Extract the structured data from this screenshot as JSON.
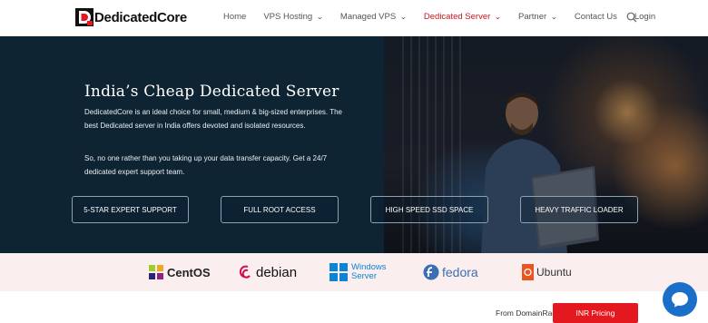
{
  "header": {
    "logo_text": "DedicatedCore",
    "nav": [
      {
        "label": "Home",
        "dropdown": false,
        "active": false
      },
      {
        "label": "VPS Hosting",
        "dropdown": true,
        "active": false
      },
      {
        "label": "Managed VPS",
        "dropdown": true,
        "active": false
      },
      {
        "label": "Dedicated Server",
        "dropdown": true,
        "active": true
      },
      {
        "label": "Partner",
        "dropdown": true,
        "active": false
      },
      {
        "label": "Contact Us",
        "dropdown": false,
        "active": false
      },
      {
        "label": "Login",
        "dropdown": false,
        "active": false
      }
    ],
    "chevron": "⌄"
  },
  "hero": {
    "title": "India’s Cheap Dedicated Server",
    "paragraph1": "DedicatedCore is an ideal choice for small, medium & big-sized enterprises. The best Dedicated server in India offers devoted and isolated resources.",
    "paragraph2": "So, no one rather than you taking up your data transfer capacity. Get a 24/7 dedicated expert support team.",
    "features": [
      "5-STAR EXPERT SUPPORT",
      "FULL ROOT ACCESS",
      "HIGH SPEED SSD SPACE",
      "HEAVY TRAFFIC LOADER"
    ]
  },
  "os_logos": [
    {
      "name": "CentOS",
      "icon": "centos-icon"
    },
    {
      "name": "debian",
      "icon": "debian-icon"
    },
    {
      "name": "Windows",
      "name2": "Server",
      "icon": "windows-icon"
    },
    {
      "name": "fedora",
      "icon": "fedora-icon"
    },
    {
      "name": "Ubuntu",
      "icon": "ubuntu-icon"
    }
  ],
  "footer_bar": {
    "from_text": "From DomainRacer",
    "inr_button": "INR Pricing"
  },
  "colors": {
    "brand_red": "#e3191f",
    "nav_active": "#c8151a",
    "hero_bg": "#0f2433",
    "chat_blue": "#1a6fc9"
  }
}
